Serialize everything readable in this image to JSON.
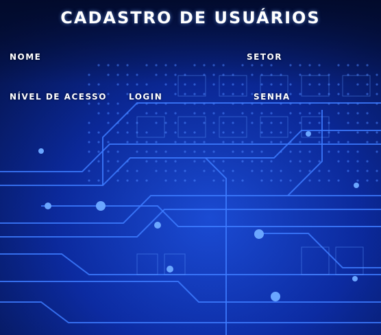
{
  "form": {
    "title": "Cadastro de Usuários",
    "labels": {
      "nome": "Nome",
      "setor": "Setor",
      "nivel_acesso": "Nível de Acesso",
      "login": "Login",
      "senha": "Senha"
    },
    "fields": {
      "nome": "",
      "setor": "",
      "nivel_acesso": "",
      "login": "",
      "senha": ""
    }
  },
  "colors": {
    "background_top": "#061a4a",
    "background_glow": "#1a4fe0",
    "circuit_line": "#3d7bff",
    "text": "#ffffff"
  },
  "background": {
    "image": "blue-circuit-board"
  }
}
